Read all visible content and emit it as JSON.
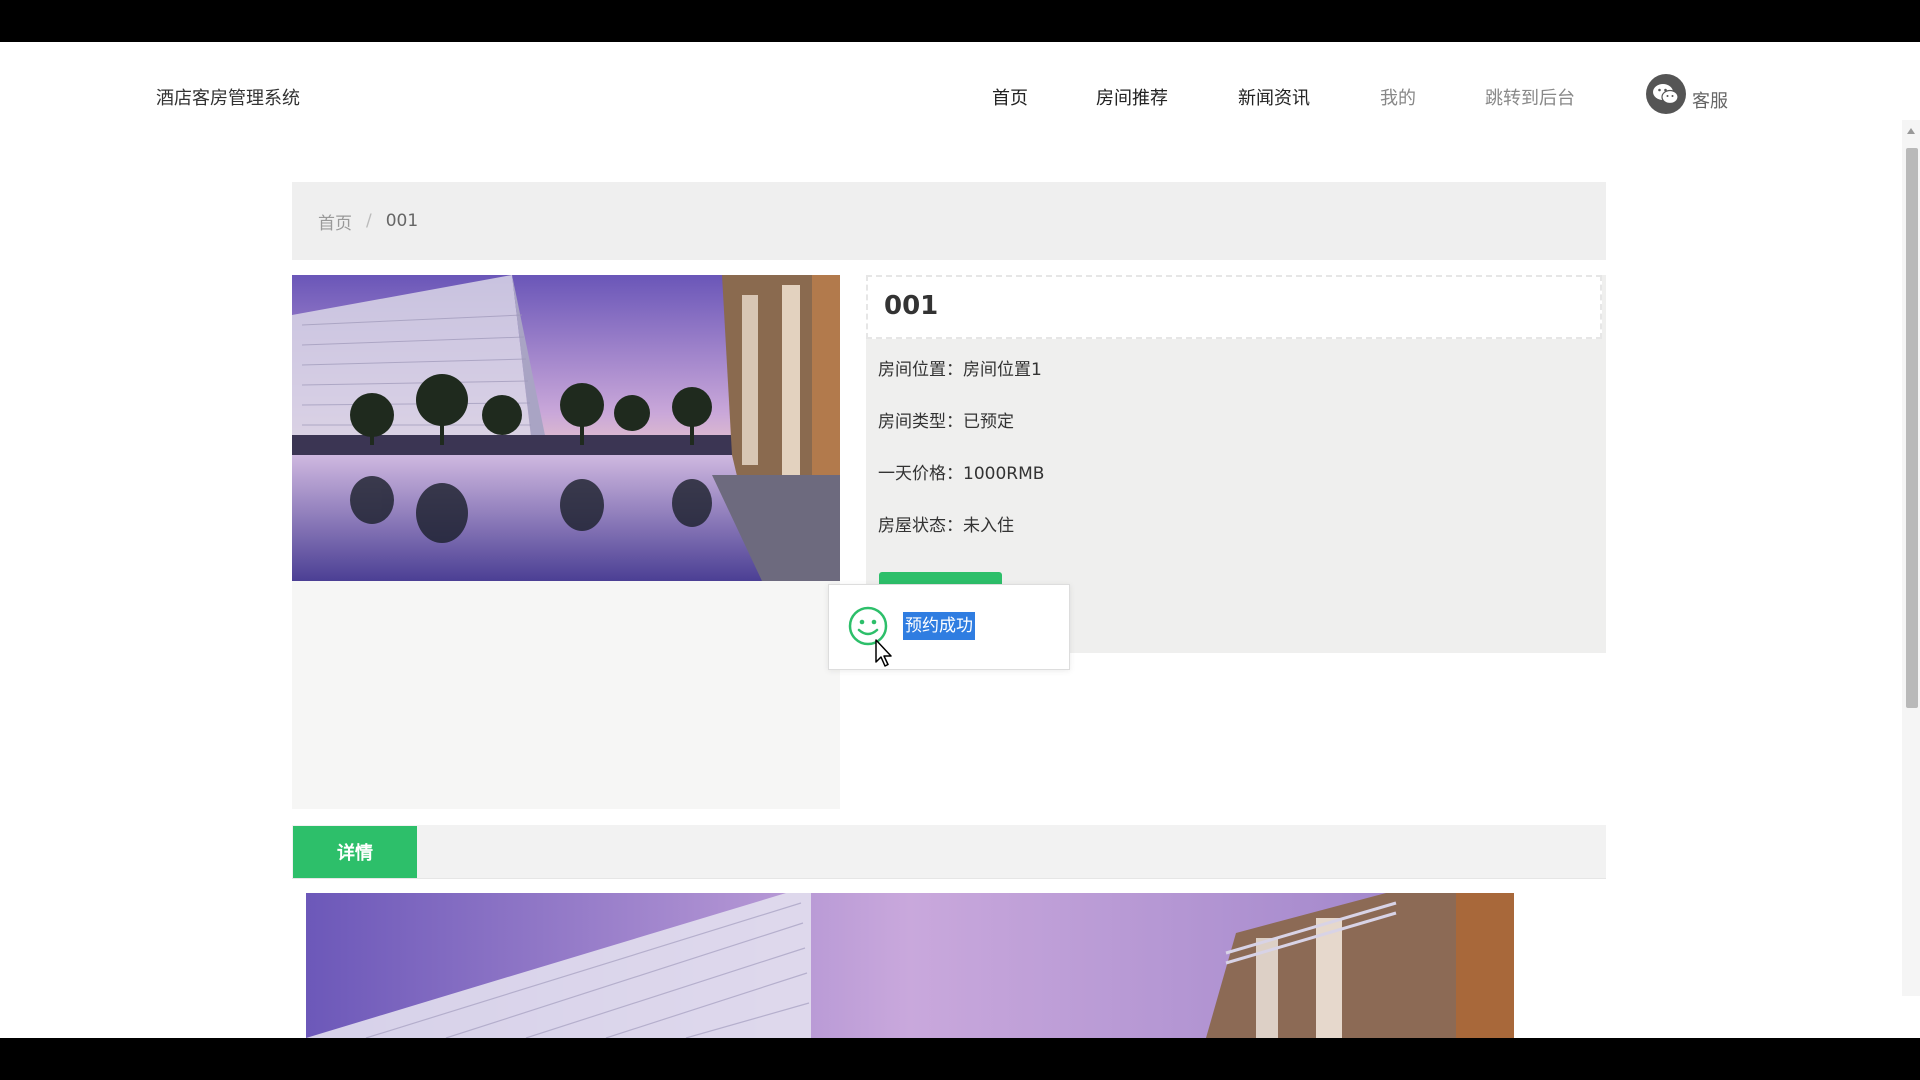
{
  "header": {
    "site_title": "酒店客房管理系统",
    "nav": [
      {
        "label": "首页"
      },
      {
        "label": "房间推荐"
      },
      {
        "label": "新闻资讯"
      },
      {
        "label": "我的"
      },
      {
        "label": "跳转到后台"
      }
    ],
    "service_label": "客服",
    "service_icon": "wechat-icon"
  },
  "breadcrumb": {
    "home": "首页",
    "separator": "/",
    "current": "001"
  },
  "room": {
    "name": "001",
    "fields": [
      {
        "key": "房间位置：",
        "value": "房间位置1"
      },
      {
        "key": "房间类型：",
        "value": "已预定"
      },
      {
        "key": "一天价格：",
        "value": "1000RMB"
      },
      {
        "key": "房屋状态：",
        "value": "未入住"
      }
    ]
  },
  "toast": {
    "message": "预约成功",
    "icon": "smile-icon"
  },
  "tabs": {
    "detail": "详情"
  },
  "colors": {
    "accent": "#2dbf6a",
    "selection": "#2f7de1"
  }
}
